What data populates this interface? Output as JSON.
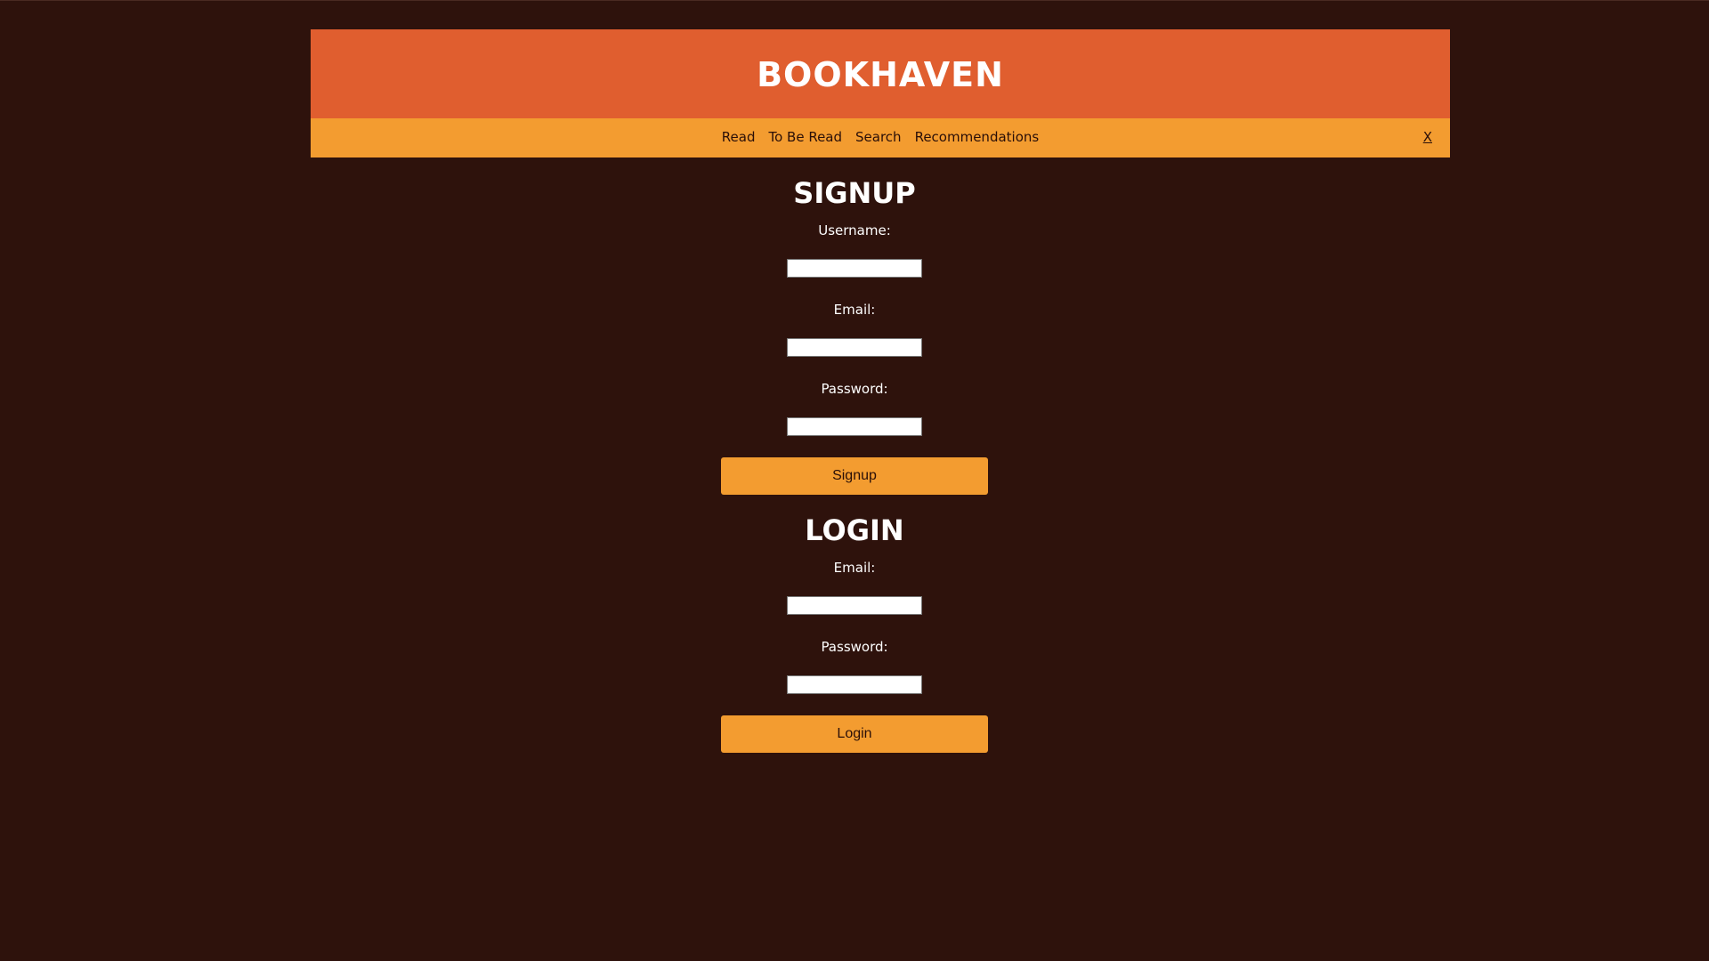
{
  "app": {
    "title": "BOOKHAVEN"
  },
  "nav": {
    "items": [
      {
        "label": "Read"
      },
      {
        "label": "To Be Read"
      },
      {
        "label": "Search"
      },
      {
        "label": "Recommendations"
      }
    ],
    "close_label": "X"
  },
  "signup": {
    "title": "SIGNUP",
    "username_label": "Username:",
    "username_value": "",
    "email_label": "Email:",
    "email_value": "",
    "password_label": "Password:",
    "password_value": "",
    "button_label": "Signup"
  },
  "login": {
    "title": "LOGIN",
    "email_label": "Email:",
    "email_value": "",
    "password_label": "Password:",
    "password_value": "",
    "button_label": "Login"
  },
  "colors": {
    "background": "#2e120c",
    "header": "#e05e2f",
    "nav": "#f39c30",
    "button": "#f39c30"
  }
}
